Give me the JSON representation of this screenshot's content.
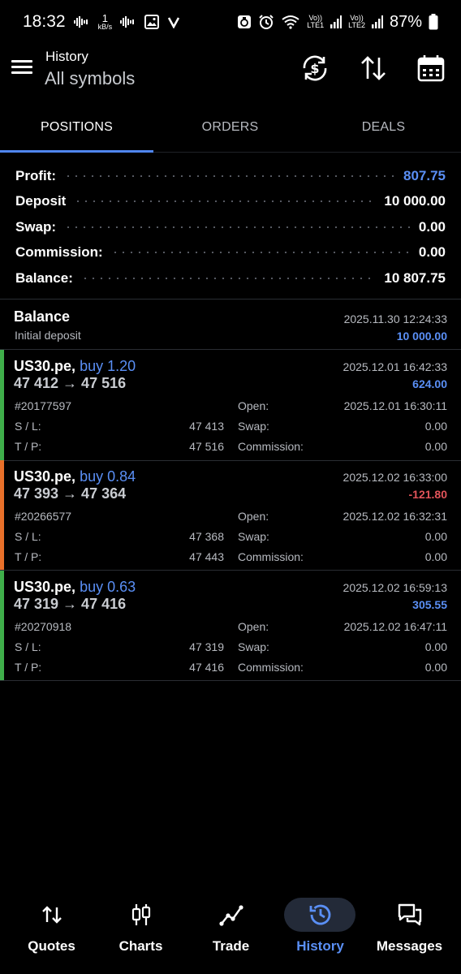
{
  "status_bar": {
    "time": "18:32",
    "net_speed_value": "1",
    "net_speed_unit": "kB/s",
    "sim1": "LTE1",
    "sim2": "LTE2",
    "vo1": "Vo))",
    "vo2": "Vo))",
    "battery": "87%"
  },
  "header": {
    "title": "History",
    "subtitle": "All symbols",
    "icons": [
      "menu-icon",
      "currency-sync-icon",
      "sort-icon",
      "calendar-icon"
    ]
  },
  "tabs": [
    {
      "label": "POSITIONS",
      "active": true
    },
    {
      "label": "ORDERS",
      "active": false
    },
    {
      "label": "DEALS",
      "active": false
    }
  ],
  "summary": [
    {
      "label": "Profit:",
      "value": "807.75",
      "accent": "#5a8ff5"
    },
    {
      "label": "Deposit",
      "value": "10 000.00"
    },
    {
      "label": "Swap:",
      "value": "0.00"
    },
    {
      "label": "Commission:",
      "value": "0.00"
    },
    {
      "label": "Balance:",
      "value": "10 807.75"
    }
  ],
  "balance_entry": {
    "title": "Balance",
    "subtitle": "Initial deposit",
    "time": "2025.11.30 12:24:33",
    "amount": "10 000.00"
  },
  "labels": {
    "sl": "S / L:",
    "tp": "T / P:",
    "open": "Open:",
    "swap": "Swap:",
    "commission": "Commission:"
  },
  "positions": [
    {
      "symbol": "US30.pe,",
      "side": "buy 1.20",
      "prices": "47 412 → 47 516",
      "close_time": "2025.12.01 16:42:33",
      "profit": "624.00",
      "profit_color": "#5a8ff5",
      "bar_color": "#3fae4a",
      "ticket": "#20177597",
      "sl": "47 413",
      "tp": "47 516",
      "open_time": "2025.12.01 16:30:11",
      "swap": "0.00",
      "commission": "0.00"
    },
    {
      "symbol": "US30.pe,",
      "side": "buy 0.84",
      "prices": "47 393 → 47 364",
      "close_time": "2025.12.02 16:33:00",
      "profit": "-121.80",
      "profit_color": "#e2545a",
      "bar_color": "#e8702a",
      "ticket": "#20266577",
      "sl": "47 368",
      "tp": "47 443",
      "open_time": "2025.12.02 16:32:31",
      "swap": "0.00",
      "commission": "0.00"
    },
    {
      "symbol": "US30.pe,",
      "side": "buy 0.63",
      "prices": "47 319 → 47 416",
      "close_time": "2025.12.02 16:59:13",
      "profit": "305.55",
      "profit_color": "#5a8ff5",
      "bar_color": "#3fae4a",
      "ticket": "#20270918",
      "sl": "47 319",
      "tp": "47 416",
      "open_time": "2025.12.02 16:47:11",
      "swap": "0.00",
      "commission": "0.00"
    }
  ],
  "bottom_nav": [
    {
      "label": "Quotes",
      "icon": "quotes-arrows-icon",
      "active": false
    },
    {
      "label": "Charts",
      "icon": "candlestick-icon",
      "active": false
    },
    {
      "label": "Trade",
      "icon": "trend-line-icon",
      "active": false
    },
    {
      "label": "History",
      "icon": "history-clock-icon",
      "active": true
    },
    {
      "label": "Messages",
      "icon": "chat-bubbles-icon",
      "active": false
    }
  ]
}
